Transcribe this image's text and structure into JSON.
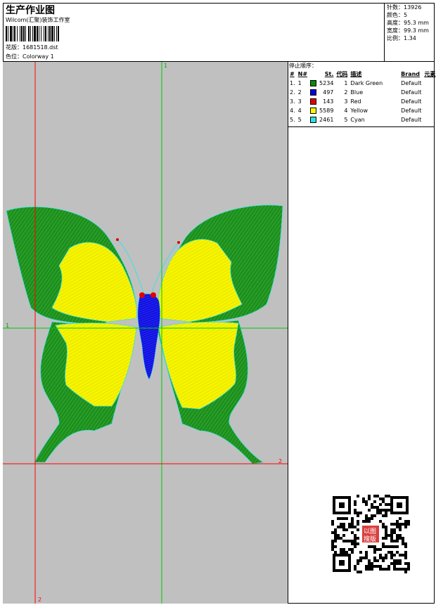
{
  "header": {
    "title": "生产作业图",
    "company": "Wilcom(汇聚)装饰工作室",
    "design_label": "花版：",
    "design_value": "1681518.dst",
    "colorway_label": "色位：",
    "colorway_value": "Colorway 1"
  },
  "stats": [
    {
      "label": "针数：",
      "value": "13926"
    },
    {
      "label": "颜色：",
      "value": "5"
    },
    {
      "label": "高度：",
      "value": "95.3 mm"
    },
    {
      "label": "宽度：",
      "value": "99.3 mm"
    },
    {
      "label": "比例：",
      "value": "1.34"
    }
  ],
  "thread_section": {
    "title": "停止顺序：",
    "columns": [
      "#",
      "N#",
      "St.",
      "代码",
      "描述",
      "Brand",
      "元素"
    ],
    "rows": [
      {
        "num": "1.",
        "n": "1",
        "color": "#0a8a0a",
        "stitches": "5234",
        "code": "1",
        "desc": "Dark Green",
        "brand": "Default"
      },
      {
        "num": "2.",
        "n": "2",
        "color": "#0000e0",
        "stitches": "497",
        "code": "2",
        "desc": "Blue",
        "brand": "Default"
      },
      {
        "num": "3.",
        "n": "3",
        "color": "#e00000",
        "stitches": "143",
        "code": "3",
        "desc": "Red",
        "brand": "Default"
      },
      {
        "num": "4.",
        "n": "4",
        "color": "#f8f800",
        "stitches": "5589",
        "code": "4",
        "desc": "Yellow",
        "brand": "Default"
      },
      {
        "num": "5.",
        "n": "5",
        "color": "#30e0e0",
        "stitches": "2461",
        "code": "5",
        "desc": "Cyan",
        "brand": "Default"
      }
    ]
  },
  "guides": {
    "top_marker": "1",
    "left_marker": "1",
    "right_marker": "2",
    "bottom_marker": "2"
  },
  "colors": {
    "canvas_bg": "#c0c0c0",
    "guide_red": "#ff0000",
    "guide_green": "#00cc00"
  },
  "qr_stamp": {
    "text": "以图搜版"
  }
}
